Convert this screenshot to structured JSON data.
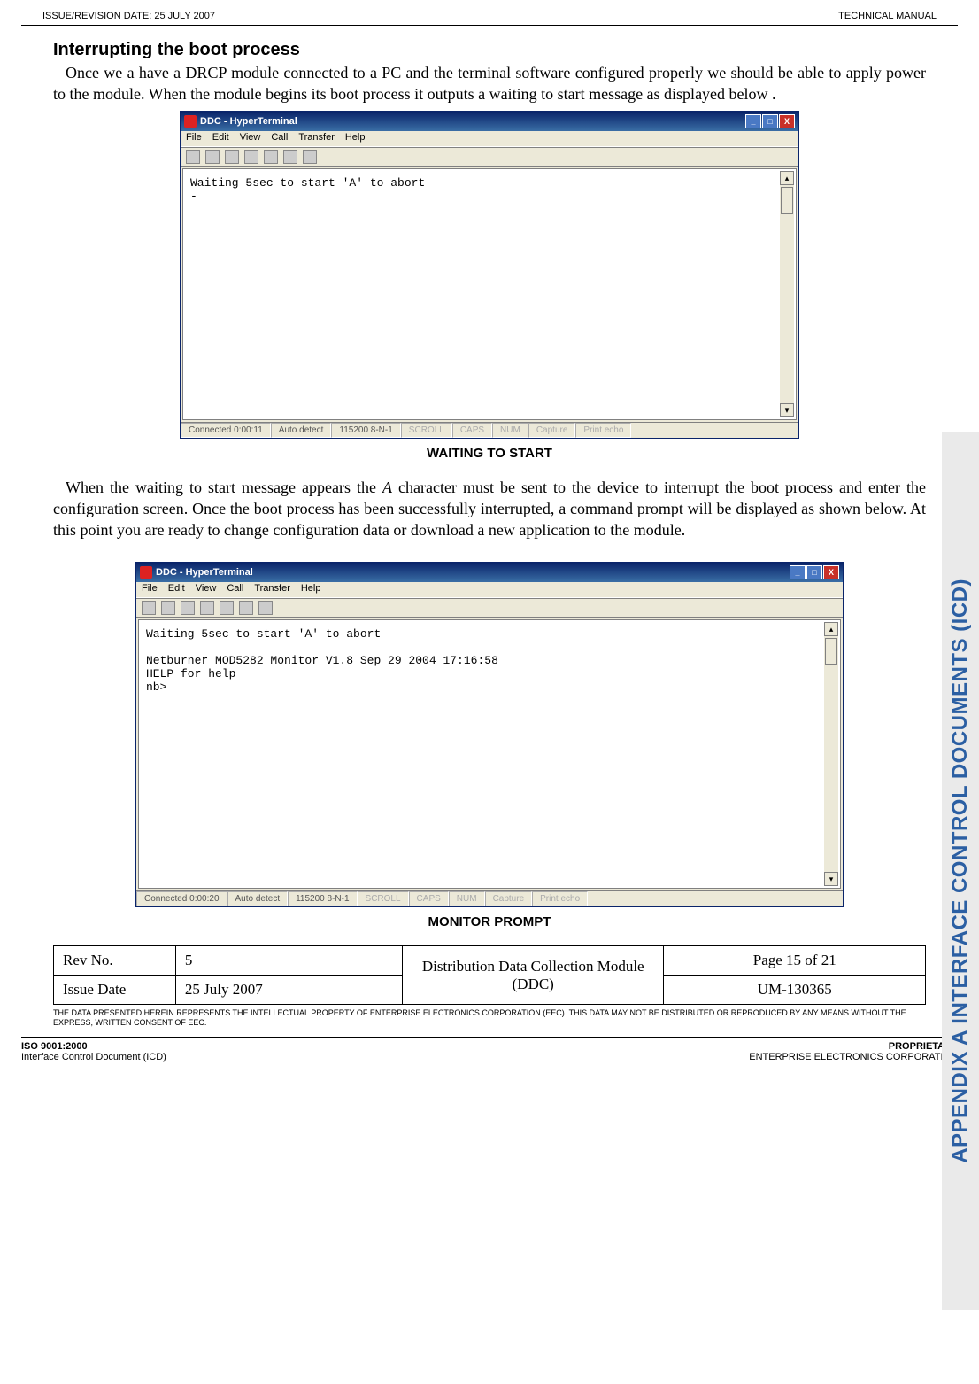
{
  "header": {
    "left": "ISSUE/REVISION DATE:  25 JULY 2007",
    "right": "TECHNICAL MANUAL"
  },
  "section": {
    "title": "Interrupting the boot process"
  },
  "para1": "Once we a have a DRCP module connected to a PC and the terminal software configured properly we should be able to apply power to the module. When the module begins its boot process it outputs a waiting to start message as displayed below .",
  "hyper": {
    "title": "DDC - HyperTerminal",
    "menus": [
      "File",
      "Edit",
      "View",
      "Call",
      "Transfer",
      "Help"
    ],
    "status": {
      "conn1": "Connected 0:00:11",
      "conn2": "Connected 0:00:20",
      "detect": "Auto detect",
      "baud": "115200 8-N-1",
      "scroll": "SCROLL",
      "caps": "CAPS",
      "num": "NUM",
      "capture": "Capture",
      "echo": "Print echo"
    }
  },
  "term1": "Waiting 5sec to start 'A' to abort\n-",
  "term2": "Waiting 5sec to start 'A' to abort\n\nNetburner MOD5282 Monitor V1.8 Sep 29 2004 17:16:58\nHELP for help\nnb>",
  "caption1": "WAITING TO START",
  "para2a": "When the waiting to start message appears the ",
  "para2b": " character must be sent to the device to interrupt the boot process and enter the configuration screen. Once the boot process has been successfully interrupted, a command prompt will be displayed as shown below.  At this point you are ready to change configuration data or download a new application to the module.",
  "para2_ital": "A",
  "caption2": "MONITOR PROMPT",
  "table": {
    "rev_label": "Rev No.",
    "rev_val": "5",
    "issue_label": "Issue Date",
    "issue_val": "25 July 2007",
    "doc_title": "Distribution Data Collection Module (DDC)",
    "page": "Page 15 of 21",
    "um": "UM-130365"
  },
  "legal": "THE DATA PRESENTED HEREIN REPRESENTS THE INTELLECTUAL PROPERTY OF ENTERPRISE ELECTRONICS CORPORATION (EEC).  THIS DATA MAY NOT BE DISTRIBUTED OR REPRODUCED BY ANY MEANS WITHOUT THE EXPRESS, WRITTEN CONSENT OF EEC.",
  "footer": {
    "l1": "ISO 9001:2000",
    "l2": "Interface Control Document (ICD)",
    "r1": "PROPRIETARY",
    "r2": "ENTERPRISE ELECTRONICS CORPORATION"
  },
  "sidetab": "APPENDIX A  INTERFACE CONTROL DOCUMENTS (ICD)"
}
